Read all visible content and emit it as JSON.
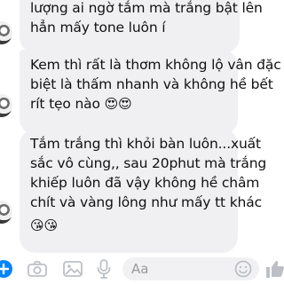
{
  "messages": [
    {
      "lines": [
        "lượng ai ngờ tắm mà trắng bật lên",
        "hẳn mấy tone luôn í"
      ]
    },
    {
      "lines": [
        "Kem thì rất là thơm không lộ vân đặc",
        "biệt là thấm nhanh và không hề bết",
        "rít tẹo nào"
      ],
      "emoji": "😍😍"
    },
    {
      "lines": [
        "Tắm trắng thì khỏi bàn luôn...xuất",
        "sắc vô cùng,, sau 20phut mà trắng",
        "khiếp luôn đã vậy không hề châm",
        "chít và vàng lông như mấy tt khác"
      ],
      "emoji": "😘😘"
    }
  ],
  "composer": {
    "placeholder": "Aa",
    "colors": {
      "accent": "#0084ff",
      "icon": "#bcc0c4"
    },
    "icons": [
      "add-icon",
      "camera-icon",
      "image-icon",
      "microphone-icon",
      "emoji-icon",
      "like-icon"
    ]
  }
}
